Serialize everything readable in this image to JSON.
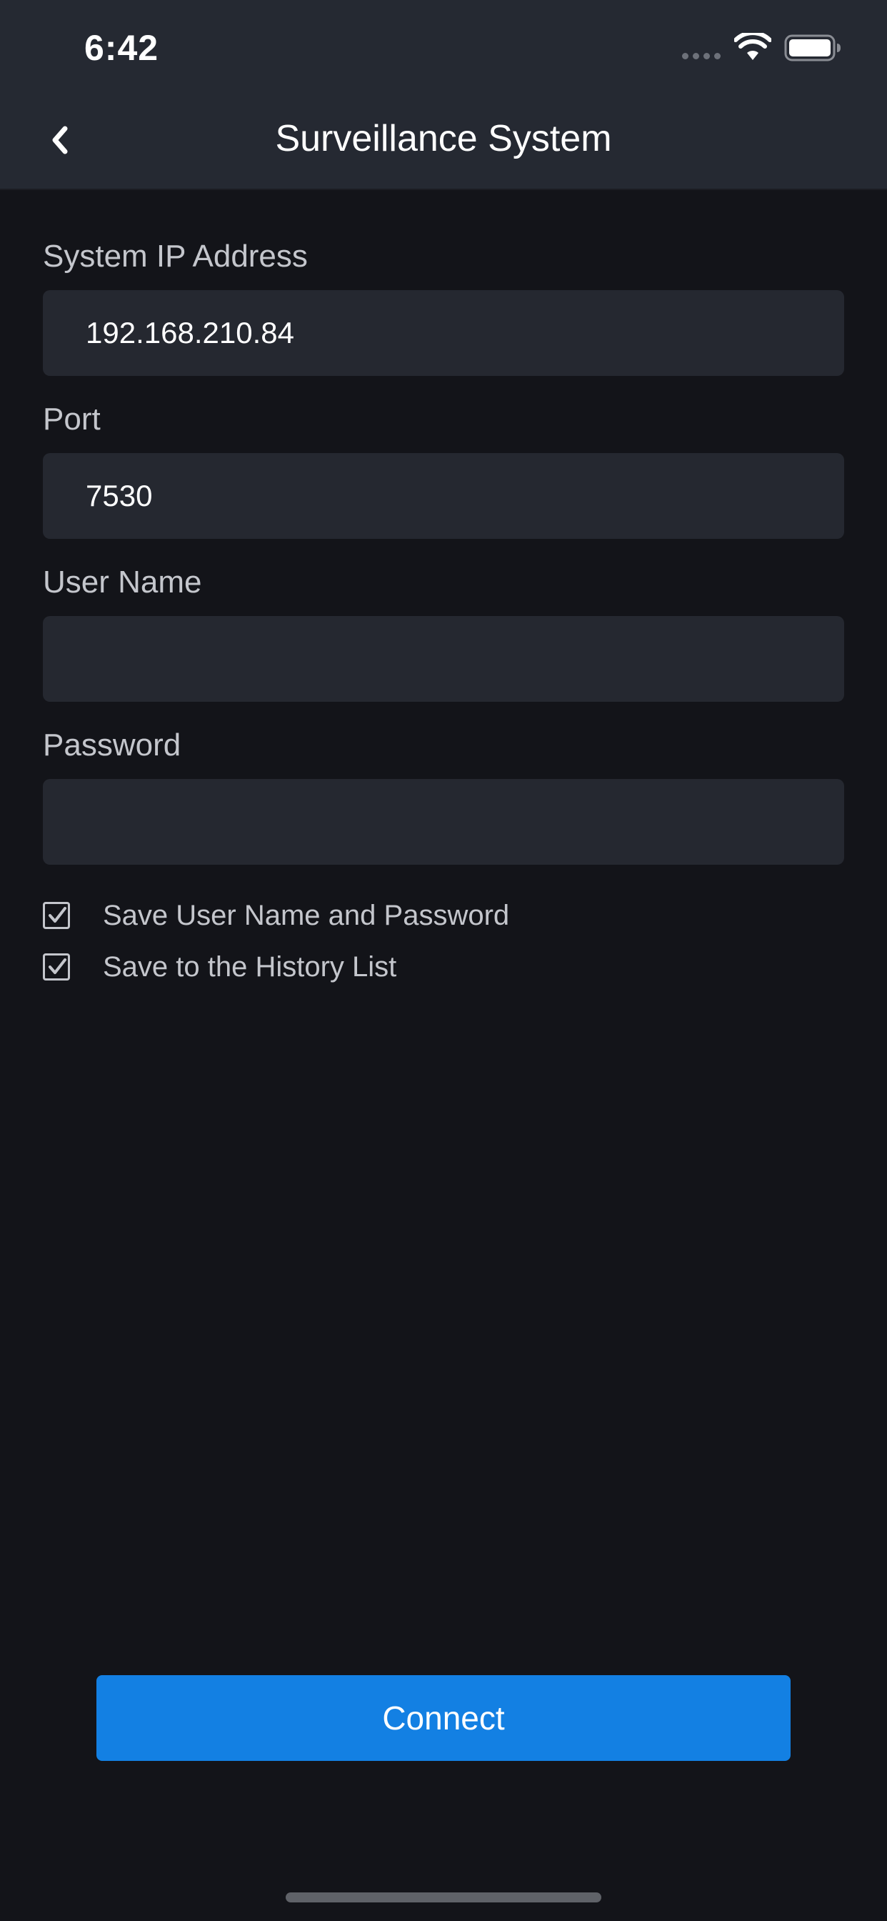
{
  "status_bar": {
    "time": "6:42",
    "icons": [
      "cellular-signal-icon",
      "wifi-icon",
      "battery-icon"
    ]
  },
  "nav": {
    "back_icon": "chevron-left-icon",
    "title": "Surveillance System"
  },
  "form": {
    "ip": {
      "label": "System IP Address",
      "value": "192.168.210.84"
    },
    "port": {
      "label": "Port",
      "value": "7530"
    },
    "username": {
      "label": "User Name",
      "value": ""
    },
    "password": {
      "label": "Password",
      "value": ""
    },
    "save_credentials": {
      "label": "Save User Name and Password",
      "checked": true
    },
    "save_history": {
      "label": "Save to the History List",
      "checked": true
    }
  },
  "connect_label": "Connect",
  "colors": {
    "background": "#131419",
    "header": "#252932",
    "input_bg": "#252830",
    "label": "#c4c6cc",
    "accent": "#1380e3"
  }
}
